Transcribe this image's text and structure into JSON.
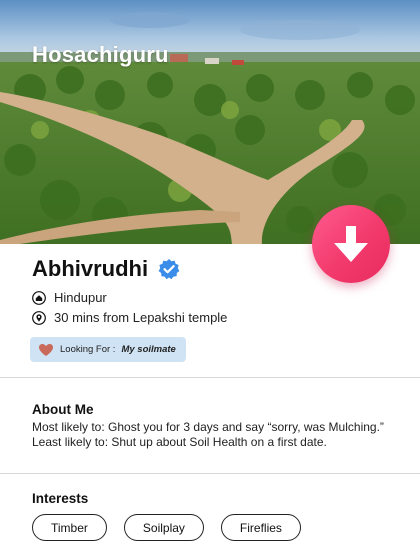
{
  "brand": {
    "name": "Hosachiguru"
  },
  "profile": {
    "name": "Abhivrudhi",
    "location": "Hindupur",
    "distance": "30 mins from Lepakshi temple",
    "looking_for_label": "Looking For :",
    "looking_for_value": "My soilmate"
  },
  "about": {
    "title": "About Me",
    "line1": "Most likely to: Ghost you for 3 days and say “sorry, was Mulching.”",
    "line2": "Least likely to: Shut up about Soil Health on a first date."
  },
  "interests": {
    "title": "Interests",
    "items": [
      "Timber",
      "Soilplay",
      "Fireflies"
    ]
  },
  "colors": {
    "accent": "#f23a6c",
    "verified": "#3a8de8",
    "pill": "#cfe3f4",
    "heart": "#c9695a"
  },
  "icons": {
    "download": "down-arrow-icon",
    "verified": "verified-check-icon",
    "home": "home-icon",
    "location": "map-pin-icon",
    "heart": "heart-icon"
  }
}
